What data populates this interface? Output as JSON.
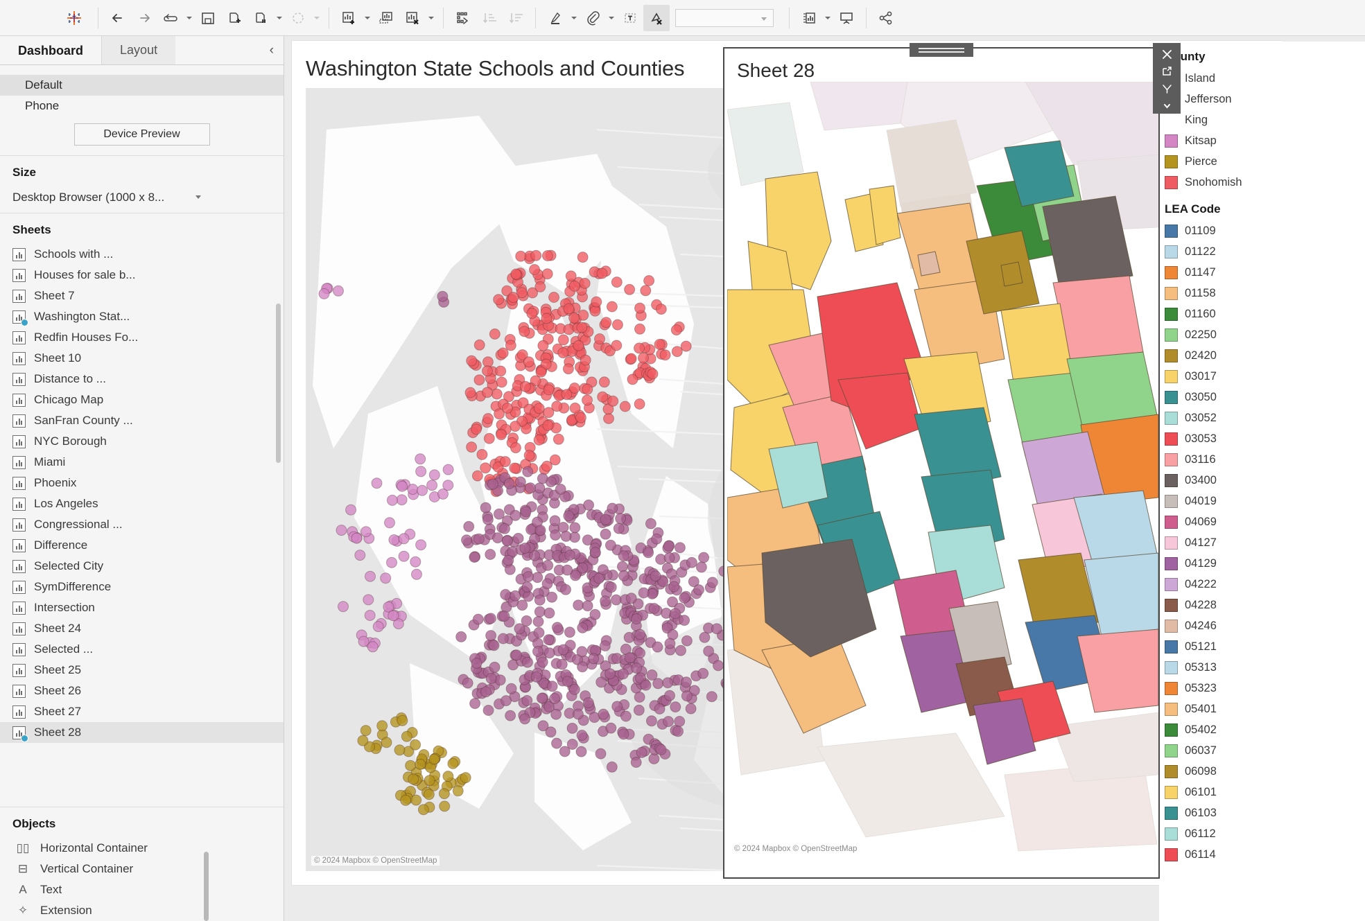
{
  "toolbar": {
    "logo_name": "tableau-logo",
    "items": [
      {
        "name": "back-button",
        "glyph": "←",
        "disabled": false,
        "caret": false
      },
      {
        "name": "forward-button",
        "glyph": "→",
        "disabled": false,
        "caret": false
      },
      {
        "name": "undo-redo-button",
        "glyph": "⇌",
        "disabled": false,
        "caret": true
      },
      {
        "name": "save-button",
        "glyph": "save",
        "disabled": false,
        "caret": false
      },
      {
        "name": "new-data-source-button",
        "glyph": "data-add",
        "disabled": false,
        "caret": false
      },
      {
        "name": "pause-data-updates-button",
        "glyph": "data-pause",
        "disabled": false,
        "caret": true
      },
      {
        "name": "refresh-data-source-button",
        "glyph": "refresh",
        "disabled": true,
        "caret": true
      },
      {
        "name": "new-worksheet-button",
        "glyph": "sheet-add",
        "disabled": false,
        "caret": true
      },
      {
        "name": "duplicate-sheet-button",
        "glyph": "sheet-dup",
        "disabled": false,
        "caret": false
      },
      {
        "name": "clear-sheet-button",
        "glyph": "sheet-clear",
        "disabled": false,
        "caret": true
      },
      {
        "name": "swap-rows-columns-button",
        "glyph": "swap",
        "disabled": false,
        "caret": false
      },
      {
        "name": "sort-ascending-button",
        "glyph": "sort-asc",
        "disabled": true,
        "caret": false
      },
      {
        "name": "sort-descending-button",
        "glyph": "sort-desc",
        "disabled": true,
        "caret": false
      },
      {
        "name": "highlight-button",
        "glyph": "highlighter",
        "disabled": false,
        "caret": true
      },
      {
        "name": "group-members-button",
        "glyph": "paperclip",
        "disabled": false,
        "caret": true
      },
      {
        "name": "show-mark-labels-button",
        "glyph": "text-label",
        "disabled": false,
        "caret": false
      },
      {
        "name": "fix-axes-button",
        "glyph": "presentation-clear",
        "disabled": false,
        "caret": false,
        "active": true
      }
    ],
    "fit_dropdown_value": "",
    "right_items": [
      {
        "name": "show-hide-cards-button",
        "glyph": "cards",
        "caret": true
      },
      {
        "name": "presentation-mode-button",
        "glyph": "presentation",
        "caret": false
      },
      {
        "name": "share-button",
        "glyph": "share",
        "caret": false
      }
    ]
  },
  "sidebar": {
    "tabs": [
      {
        "name": "tab-dashboard",
        "label": "Dashboard",
        "selected": true
      },
      {
        "name": "tab-layout",
        "label": "Layout",
        "selected": false
      }
    ],
    "collapse_glyph": "‹",
    "device_section": {
      "rows": [
        {
          "label": "Default",
          "selected": true
        },
        {
          "label": "Phone",
          "selected": false
        }
      ],
      "device_preview_label": "Device Preview"
    },
    "size_section": {
      "heading": "Size",
      "value": "Desktop Browser (1000 x 8..."
    },
    "sheets_section": {
      "heading": "Sheets",
      "items": [
        {
          "label": "Schools with ...",
          "selected": false,
          "badge": false
        },
        {
          "label": "Houses for sale b...",
          "selected": false,
          "badge": false
        },
        {
          "label": "Sheet 7",
          "selected": false,
          "badge": false
        },
        {
          "label": "Washington Stat...",
          "selected": false,
          "badge": true
        },
        {
          "label": "Redfin Houses Fo...",
          "selected": false,
          "badge": false
        },
        {
          "label": "Sheet 10",
          "selected": false,
          "badge": false
        },
        {
          "label": "Distance to ...",
          "selected": false,
          "badge": false
        },
        {
          "label": "Chicago Map",
          "selected": false,
          "badge": false
        },
        {
          "label": "SanFran County ...",
          "selected": false,
          "badge": false
        },
        {
          "label": "NYC Borough",
          "selected": false,
          "badge": false
        },
        {
          "label": "Miami",
          "selected": false,
          "badge": false
        },
        {
          "label": "Phoenix",
          "selected": false,
          "badge": false
        },
        {
          "label": "Los Angeles",
          "selected": false,
          "badge": false
        },
        {
          "label": "Congressional ...",
          "selected": false,
          "badge": false
        },
        {
          "label": "Difference",
          "selected": false,
          "badge": false
        },
        {
          "label": "Selected City",
          "selected": false,
          "badge": false
        },
        {
          "label": "SymDifference",
          "selected": false,
          "badge": false
        },
        {
          "label": "Intersection",
          "selected": false,
          "badge": false
        },
        {
          "label": "Sheet 24",
          "selected": false,
          "badge": false
        },
        {
          "label": "Selected ...",
          "selected": false,
          "badge": false
        },
        {
          "label": "Sheet 25",
          "selected": false,
          "badge": false
        },
        {
          "label": "Sheet 26",
          "selected": false,
          "badge": false
        },
        {
          "label": "Sheet 27",
          "selected": false,
          "badge": false
        },
        {
          "label": "Sheet 28",
          "selected": true,
          "badge": true
        }
      ]
    },
    "objects_section": {
      "heading": "Objects",
      "items": [
        {
          "label": "Horizontal Container",
          "glyph": "▯▯",
          "icon_name": "horizontal-container-icon"
        },
        {
          "label": "Vertical Container",
          "glyph": "⊟",
          "icon_name": "vertical-container-icon"
        },
        {
          "label": "Text",
          "glyph": "A",
          "icon_name": "text-icon"
        },
        {
          "label": "Extension",
          "glyph": "✧",
          "icon_name": "extension-icon"
        }
      ]
    }
  },
  "dashboard": {
    "title": "Washington State Schools and Counties",
    "schools_map": {
      "attribution": "© 2024 Mapbox © OpenStreetMap"
    },
    "floating_sheet": {
      "title": "Sheet 28",
      "attribution": "© 2024 Mapbox © OpenStreetMap"
    }
  },
  "dark_toolbar": {
    "buttons": [
      {
        "name": "close-icon",
        "glyph": "✕"
      },
      {
        "name": "open-external-icon",
        "glyph": "↗"
      },
      {
        "name": "filter-funnel-icon",
        "glyph": "⋎"
      },
      {
        "name": "more-options-caret-icon",
        "glyph": "▾"
      }
    ]
  },
  "legends": {
    "county": {
      "title": "County",
      "items": [
        {
          "label": "Island",
          "color": "#76b7b2"
        },
        {
          "label": "Jefferson",
          "color": "#edc948"
        },
        {
          "label": "King",
          "color": "#59a14f"
        },
        {
          "label": "Kitsap",
          "color": "#d486c4"
        },
        {
          "label": "Pierce",
          "color": "#b5931f"
        },
        {
          "label": "Snohomish",
          "color": "#ef5b62"
        }
      ]
    },
    "lea_code": {
      "title": "LEA Code",
      "items": [
        {
          "label": "01109",
          "color": "#4878a8"
        },
        {
          "label": "01122",
          "color": "#b9d9e8"
        },
        {
          "label": "01147",
          "color": "#ef8636"
        },
        {
          "label": "01158",
          "color": "#f5bd7e"
        },
        {
          "label": "01160",
          "color": "#3b8b3b"
        },
        {
          "label": "02250",
          "color": "#8fd48a"
        },
        {
          "label": "02420",
          "color": "#b08d2a"
        },
        {
          "label": "03017",
          "color": "#f7d36a"
        },
        {
          "label": "03050",
          "color": "#3a9191"
        },
        {
          "label": "03052",
          "color": "#a9ddd7"
        },
        {
          "label": "03053",
          "color": "#ef4d56"
        },
        {
          "label": "03116",
          "color": "#f8a0a4"
        },
        {
          "label": "03400",
          "color": "#6b6160"
        },
        {
          "label": "04019",
          "color": "#c7bdb9"
        },
        {
          "label": "04069",
          "color": "#cf5e8f"
        },
        {
          "label": "04127",
          "color": "#f7c6d8"
        },
        {
          "label": "04129",
          "color": "#a062a0"
        },
        {
          "label": "04222",
          "color": "#cda8d6"
        },
        {
          "label": "04228",
          "color": "#8a5a4a"
        },
        {
          "label": "04246",
          "color": "#e2bba6"
        },
        {
          "label": "05121",
          "color": "#4878a8"
        },
        {
          "label": "05313",
          "color": "#b9d9e8"
        },
        {
          "label": "05323",
          "color": "#ef8636"
        },
        {
          "label": "05401",
          "color": "#f5bd7e"
        },
        {
          "label": "05402",
          "color": "#3b8b3b"
        },
        {
          "label": "06037",
          "color": "#8fd48a"
        },
        {
          "label": "06098",
          "color": "#b08d2a"
        },
        {
          "label": "06101",
          "color": "#f7d36a"
        },
        {
          "label": "06103",
          "color": "#3a9191"
        },
        {
          "label": "06112",
          "color": "#a9ddd7"
        },
        {
          "label": "06114",
          "color": "#ef4d56"
        }
      ]
    }
  },
  "map_data": {
    "schools_scatter": {
      "type": "scatter",
      "county_colors": {
        "Snohomish": "#ef5b62",
        "King": "#a8628f",
        "Kitsap": "#d486c4",
        "Pierce": "#b5931f",
        "Island": "#76b7b2"
      }
    }
  }
}
